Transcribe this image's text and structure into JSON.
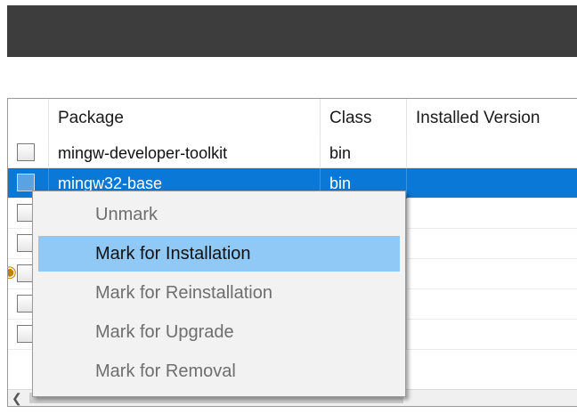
{
  "table": {
    "columns": [
      {
        "label": ""
      },
      {
        "label": "Package"
      },
      {
        "label": "Class"
      },
      {
        "label": "Installed Version"
      }
    ],
    "rows": [
      {
        "package": "mingw-developer-toolkit",
        "class": "bin",
        "installed": "",
        "selected": false
      },
      {
        "package": "mingw32-base",
        "class": "bin",
        "installed": "",
        "selected": true
      },
      {
        "package": "",
        "class": "",
        "installed": "",
        "selected": false
      },
      {
        "package": "",
        "class": "",
        "installed": "",
        "selected": false
      },
      {
        "package": "",
        "class": "",
        "installed": "",
        "selected": false
      },
      {
        "package": "",
        "class": "",
        "installed": "",
        "selected": false
      },
      {
        "package": "",
        "class": "",
        "installed": "",
        "selected": false
      }
    ]
  },
  "context_menu": {
    "items": [
      {
        "label": "Unmark",
        "enabled": false,
        "highlighted": false
      },
      {
        "label": "Mark for Installation",
        "enabled": true,
        "highlighted": true
      },
      {
        "label": "Mark for Reinstallation",
        "enabled": false,
        "highlighted": false
      },
      {
        "label": "Mark for Upgrade",
        "enabled": false,
        "highlighted": false
      },
      {
        "label": "Mark for Removal",
        "enabled": false,
        "highlighted": false
      }
    ]
  },
  "icons": {
    "checkbox": "checkbox-icon",
    "status": "package-status-icon",
    "scroll_left": "scroll-left-arrow-icon"
  },
  "colors": {
    "selection": "#0a78d7",
    "menu_highlight": "#90c8f6",
    "title_bar": "#3d3d3d"
  }
}
